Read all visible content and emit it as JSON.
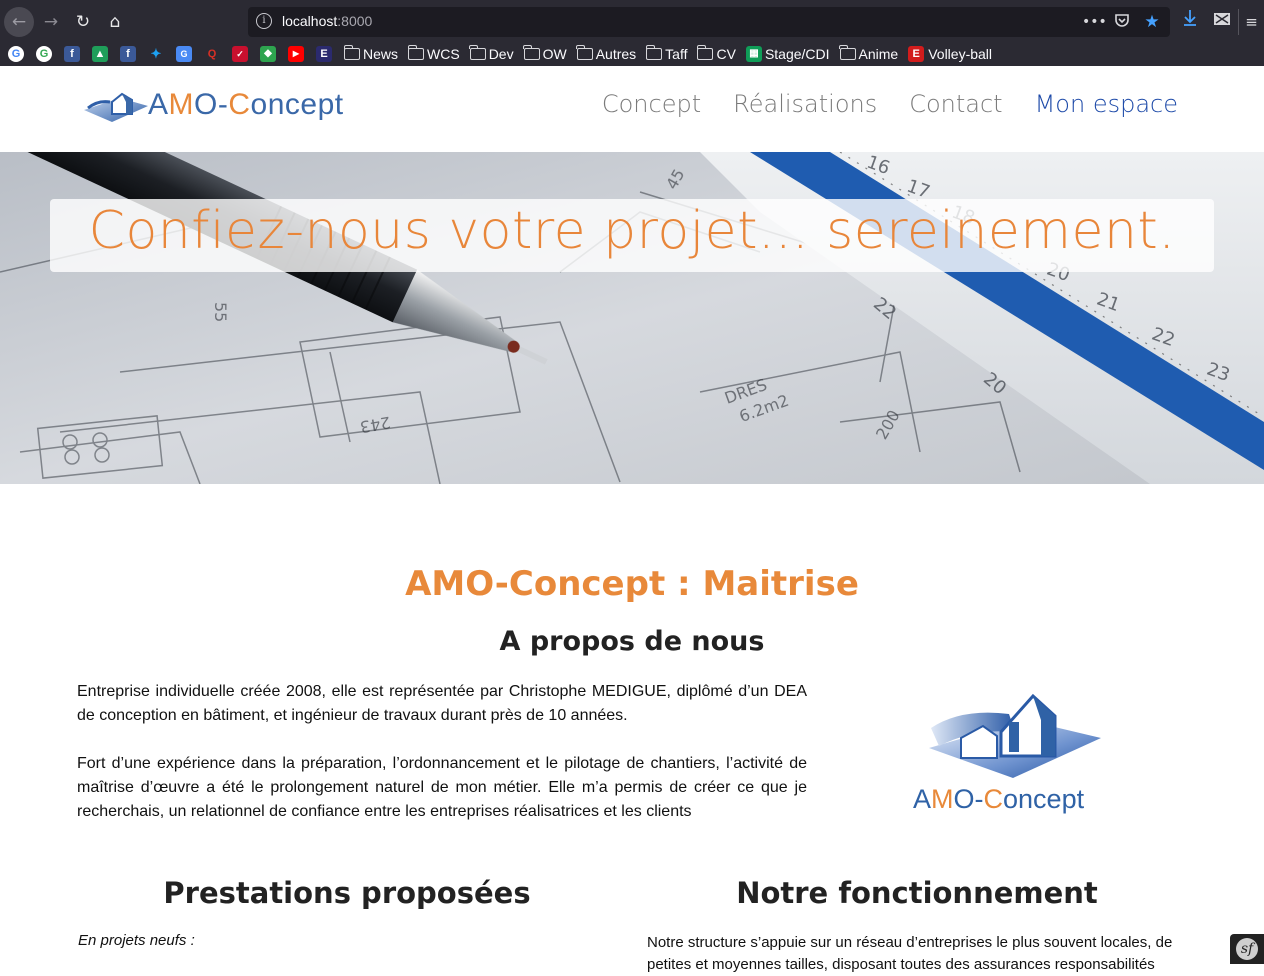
{
  "browser": {
    "url_host": "localhost",
    "url_port": ":8000",
    "bookmarks": {
      "folders": [
        "News",
        "WCS",
        "Dev",
        "OW",
        "Autres",
        "Taff",
        "CV"
      ],
      "stage": "Stage/CDI",
      "anime": "Anime",
      "volley": "Volley-ball"
    }
  },
  "header": {
    "logo_a": "A",
    "logo_m": "M",
    "logo_o1": "O-",
    "logo_c": "C",
    "logo_rest": "oncept",
    "nav": [
      "Concept",
      "Réalisations",
      "Contact",
      "Mon espace"
    ]
  },
  "hero": {
    "title": "Confiez-nous votre projet... sereinement."
  },
  "about": {
    "heading_main": "AMO-Concept : Maitrise",
    "heading": "A propos de nous",
    "paragraph1": "Entreprise individuelle créée 2008, elle est représentée par Christophe MEDIGUE, diplômé d’un DEA de conception en bâtiment, et ingénieur de travaux durant près de 10 années.",
    "paragraph2": "Fort d’une expérience dans la préparation, l’ordonnancement et le pilotage de chantiers, l’activité de maîtrise d’œuvre a été le prolongement naturel de mon métier. Elle m’a permis de créer ce que je recherchais, un relationnel de confiance entre les entreprises réalisatrices et les clients",
    "logo_a": "A",
    "logo_m": "M",
    "logo_o1": "O-",
    "logo_c": "C",
    "logo_rest": "oncept"
  },
  "services": {
    "heading": "Prestations proposées",
    "intro": "En projets neufs :"
  },
  "operation": {
    "heading": "Notre fonctionnement",
    "text": "Notre structure s’appuie sur un réseau d’entreprises le plus souvent locales, de petites et moyennes tailles, disposant toutes des assurances responsabilités"
  },
  "colors": {
    "accent": "#e8893a",
    "brand_blue": "#1c49a8",
    "chrome_bg": "#2b2a33"
  }
}
